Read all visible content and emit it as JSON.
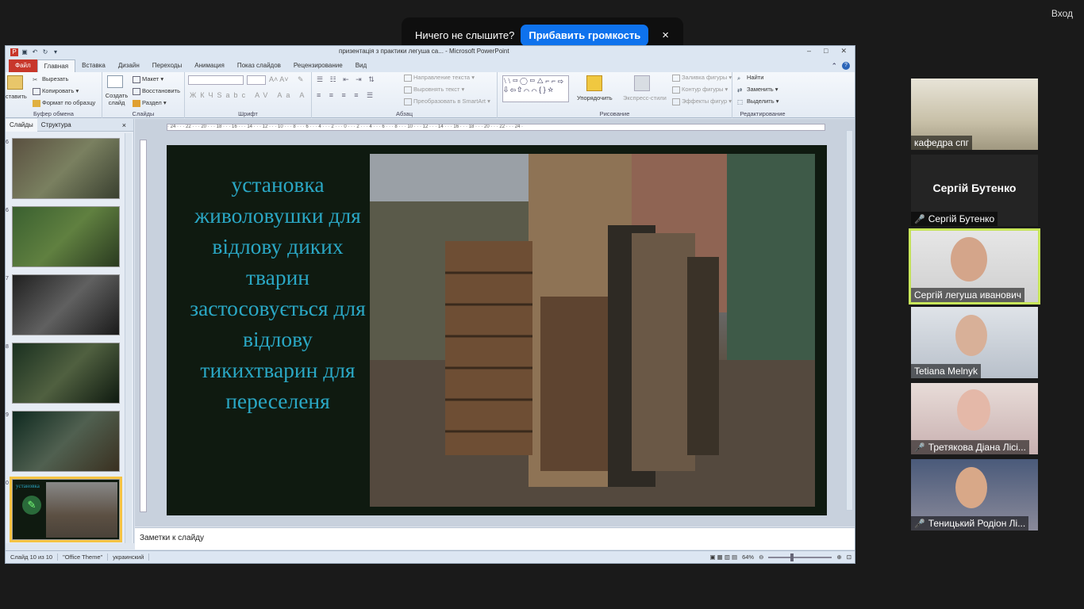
{
  "zoom": {
    "login_label": "Вход",
    "notification": {
      "message": "Ничего не слышите?",
      "button_label": "Прибавить громкость",
      "close_label": "×"
    }
  },
  "powerpoint": {
    "window_title": "призентація з практики легуша са... - Microsoft PowerPoint",
    "window_controls": [
      "–",
      "□",
      "✕"
    ],
    "tabs": [
      "Файл",
      "Главная",
      "Вставка",
      "Дизайн",
      "Переходы",
      "Анимация",
      "Показ слайдов",
      "Рецензирование",
      "Вид"
    ],
    "active_tab": "Главная",
    "ribbon": {
      "clipboard": {
        "label": "Буфер обмена",
        "paste": "ставить",
        "cut": "Вырезать",
        "copy": "Копировать",
        "format": "Формат по образцу"
      },
      "slides": {
        "label": "Слайды",
        "create": "Создать слайд",
        "layout": "Макет",
        "reset": "Восстановить",
        "section": "Раздел"
      },
      "font": {
        "label": "Шрифт"
      },
      "paragraph": {
        "label": "Абзац",
        "text_direction": "Направление текста",
        "align_text": "Выровнять текст",
        "smartart": "Преобразовать в SmartArt"
      },
      "drawing": {
        "label": "Рисование",
        "arrange": "Упорядочить",
        "quick_styles": "Экспресс-стили",
        "fill": "Заливка фигуры",
        "outline": "Контур фигуры",
        "effects": "Эффекты фигур"
      },
      "editing": {
        "label": "Редактирование",
        "find": "Найти",
        "replace": "Заменить",
        "select": "Выделить"
      }
    },
    "panel_tabs": [
      "Слайды",
      "Структура"
    ],
    "panel_close": "×",
    "thumbnails": [
      {
        "num": "6",
        "caption": ""
      },
      {
        "num": "6",
        "caption": ""
      },
      {
        "num": "7",
        "caption": ""
      },
      {
        "num": "8",
        "caption": ""
      },
      {
        "num": "9",
        "caption": ""
      },
      {
        "num": "0",
        "caption": "установка"
      }
    ],
    "slide_text": "установка живоловушки для відлову диких тварин застосовується для відлову тикихтварин для переселеня",
    "ruler_text": "· 24 · · · 22 · · · 20 · · · 18 · · · 16 · · · 14 · · · 12 · · · 10 · · · 8 · · · 6 · · · 4 · · · 2 · · · 0 · · · 2 · · · 4 · · · 6 · · · 8 · · · 10 · · · 12 · · · 14 · · · 16 · · · 18 · · · 20 · · · 22 · · · 24 ·",
    "notes_placeholder": "Заметки к слайду",
    "status": {
      "slide": "Слайд 10 из 10",
      "theme": "\"Office Theme\"",
      "language": "украинский",
      "zoom": "64%"
    }
  },
  "participants": [
    {
      "name": "кафедра спг",
      "muted": false,
      "video": true
    },
    {
      "name": "Сергій Бутенко",
      "big_name": "Сергій Бутенко",
      "muted": true,
      "video": false
    },
    {
      "name": "Сергій легуша иванович",
      "muted": false,
      "video": true,
      "active_speaker": true
    },
    {
      "name": "Tetiana Melnyk",
      "muted": false,
      "video": true
    },
    {
      "name": "Третякова Діана  Лісі...",
      "muted": true,
      "video": true
    },
    {
      "name": "Теницький Родіон Лі...",
      "muted": true,
      "video": true
    }
  ],
  "colors": {
    "slide_text": "#2aa7c4",
    "zoom_button": "#0e72ed",
    "active_speaker": "#c7e55a",
    "muted_icon": "#e0242a"
  }
}
